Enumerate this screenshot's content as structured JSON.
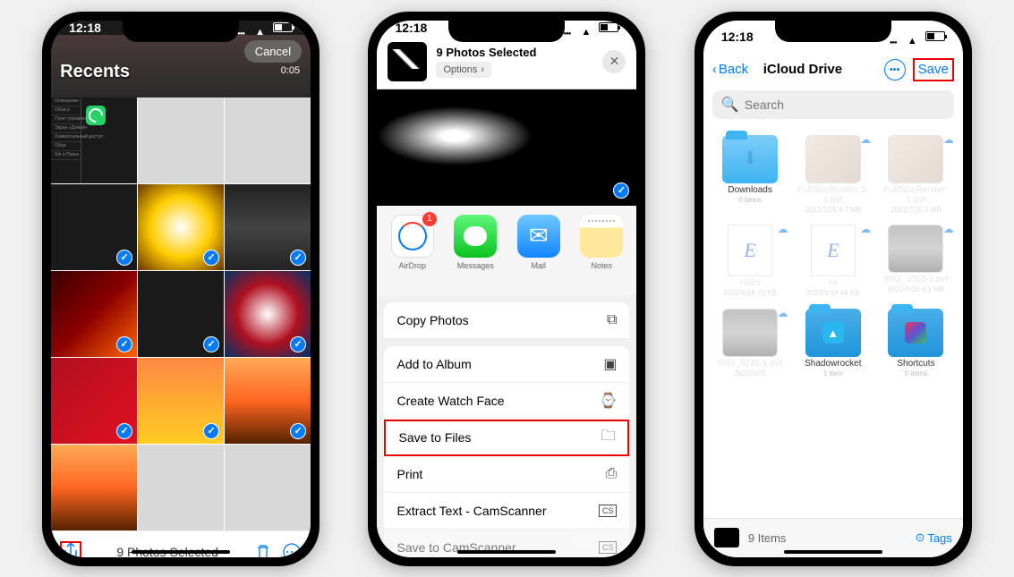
{
  "status": {
    "time": "12:18"
  },
  "screen1": {
    "recents_label": "Recents",
    "cancel_label": "Cancel",
    "video_time": "0:05",
    "selected_label": "9 Photos Selected",
    "sidebar_items": [
      "Освещение",
      "Обои и",
      "Пункт управления",
      "Экран «Домой»",
      "Универсальный доступ",
      "Обои",
      "Siri и Поиск"
    ]
  },
  "screen2": {
    "title": "9 Photos Selected",
    "options_label": "Options",
    "airdrop_badge": "1",
    "apps": [
      {
        "label": "AirDrop"
      },
      {
        "label": "Messages"
      },
      {
        "label": "Mail"
      },
      {
        "label": "Notes"
      }
    ],
    "actions": [
      {
        "label": "Copy Photos",
        "icon": "⧉"
      },
      {
        "label": "Add to Album",
        "icon": "▣"
      },
      {
        "label": "Create Watch Face",
        "icon": "⌚"
      },
      {
        "label": "Save to Files",
        "icon": "🗀",
        "highlighted": true
      },
      {
        "label": "Print",
        "icon": "⎙"
      },
      {
        "label": "Extract Text - CamScanner",
        "icon": "CS"
      },
      {
        "label": "Save to CamScanner",
        "icon": "CS"
      }
    ]
  },
  "screen3": {
    "back_label": "Back",
    "title": "iCloud Drive",
    "save_label": "Save",
    "search_placeholder": "Search",
    "items": [
      {
        "name": "Downloads",
        "meta": "0 items",
        "type": "folder-dl"
      },
      {
        "name": "FullSizeRender 2-1.pvt",
        "meta": "2022/7/25\n4.7 MB",
        "type": "img",
        "faded": true
      },
      {
        "name": "FullSizeRender-1.pvt",
        "meta": "2022/7/25\n5 MB",
        "type": "img",
        "faded": true
      },
      {
        "name": "Hello",
        "meta": "2022/6/18\n78 KB",
        "type": "doc-e",
        "faded": true
      },
      {
        "name": "Hi",
        "meta": "2022/6/18\n46 KB",
        "type": "doc-e",
        "faded": true
      },
      {
        "name": "IMG_6563-1.pvt",
        "meta": "2022/7/25\n6.1 MB",
        "type": "img",
        "faded": true
      },
      {
        "name": "IMG_9245-1.pvt",
        "meta": "2022/8/25",
        "type": "img",
        "faded": true
      },
      {
        "name": "Shadowrocket",
        "meta": "1 item",
        "type": "folder"
      },
      {
        "name": "Shortcuts",
        "meta": "0 items",
        "type": "folder-app"
      }
    ],
    "bottom_count": "9 Items",
    "tags_label": "Tags"
  }
}
